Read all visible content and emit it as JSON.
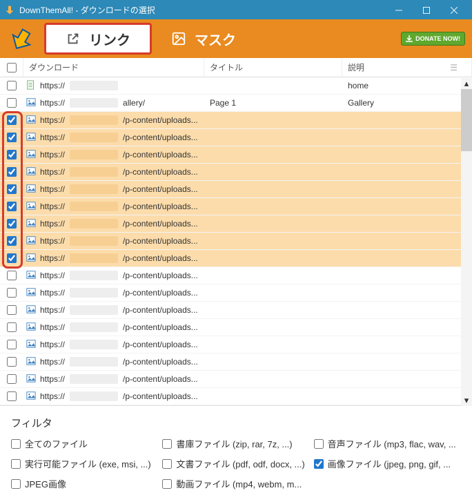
{
  "window": {
    "title": "DownThemAll! - ダウンロードの選択"
  },
  "toolbar": {
    "tab_links": "リンク",
    "tab_media": "マスク",
    "donate": "DONATE NOW!"
  },
  "columns": {
    "download": "ダウンロード",
    "title": "タイトル",
    "description": "説明"
  },
  "rows": [
    {
      "checked": false,
      "selected": false,
      "icon": "page",
      "url_prefix": "https://",
      "url_suffix": "",
      "title": "",
      "desc": "home"
    },
    {
      "checked": false,
      "selected": false,
      "icon": "img",
      "url_prefix": "https://",
      "url_suffix": "allery/",
      "title": "Page 1",
      "desc": "Gallery"
    },
    {
      "checked": true,
      "selected": true,
      "icon": "img",
      "url_prefix": "https://",
      "url_suffix": "/p-content/uploads...",
      "title": "",
      "desc": ""
    },
    {
      "checked": true,
      "selected": true,
      "icon": "img",
      "url_prefix": "https://",
      "url_suffix": "/p-content/uploads...",
      "title": "",
      "desc": ""
    },
    {
      "checked": true,
      "selected": true,
      "icon": "img",
      "url_prefix": "https://",
      "url_suffix": "/p-content/uploads...",
      "title": "",
      "desc": ""
    },
    {
      "checked": true,
      "selected": true,
      "icon": "img",
      "url_prefix": "https://",
      "url_suffix": "/p-content/uploads...",
      "title": "",
      "desc": ""
    },
    {
      "checked": true,
      "selected": true,
      "icon": "img",
      "url_prefix": "https://",
      "url_suffix": "/p-content/uploads...",
      "title": "",
      "desc": ""
    },
    {
      "checked": true,
      "selected": true,
      "icon": "img",
      "url_prefix": "https://",
      "url_suffix": "/p-content/uploads...",
      "title": "",
      "desc": ""
    },
    {
      "checked": true,
      "selected": true,
      "icon": "img",
      "url_prefix": "https://",
      "url_suffix": "/p-content/uploads...",
      "title": "",
      "desc": ""
    },
    {
      "checked": true,
      "selected": true,
      "icon": "img",
      "url_prefix": "https://",
      "url_suffix": "/p-content/uploads...",
      "title": "",
      "desc": ""
    },
    {
      "checked": true,
      "selected": true,
      "icon": "img",
      "url_prefix": "https://",
      "url_suffix": "/p-content/uploads...",
      "title": "",
      "desc": ""
    },
    {
      "checked": false,
      "selected": false,
      "icon": "img",
      "url_prefix": "https://",
      "url_suffix": "/p-content/uploads...",
      "title": "",
      "desc": ""
    },
    {
      "checked": false,
      "selected": false,
      "icon": "img",
      "url_prefix": "https://",
      "url_suffix": "/p-content/uploads...",
      "title": "",
      "desc": ""
    },
    {
      "checked": false,
      "selected": false,
      "icon": "img",
      "url_prefix": "https://",
      "url_suffix": "/p-content/uploads...",
      "title": "",
      "desc": ""
    },
    {
      "checked": false,
      "selected": false,
      "icon": "img",
      "url_prefix": "https://",
      "url_suffix": "/p-content/uploads...",
      "title": "",
      "desc": ""
    },
    {
      "checked": false,
      "selected": false,
      "icon": "img",
      "url_prefix": "https://",
      "url_suffix": "/p-content/uploads...",
      "title": "",
      "desc": ""
    },
    {
      "checked": false,
      "selected": false,
      "icon": "img",
      "url_prefix": "https://",
      "url_suffix": "/p-content/uploads...",
      "title": "",
      "desc": ""
    },
    {
      "checked": false,
      "selected": false,
      "icon": "img",
      "url_prefix": "https://",
      "url_suffix": "/p-content/uploads...",
      "title": "",
      "desc": ""
    },
    {
      "checked": false,
      "selected": false,
      "icon": "img",
      "url_prefix": "https://",
      "url_suffix": "/p-content/uploads...",
      "title": "",
      "desc": ""
    }
  ],
  "filters": {
    "heading": "フィルタ",
    "items": [
      {
        "label": "全てのファイル",
        "checked": false
      },
      {
        "label": "書庫ファイル (zip, rar, 7z, ...)",
        "checked": false
      },
      {
        "label": "音声ファイル (mp3, flac, wav, ...",
        "checked": false
      },
      {
        "label": "実行可能ファイル (exe, msi, ...)",
        "checked": false
      },
      {
        "label": "文書ファイル (pdf, odf, docx, ...)",
        "checked": false
      },
      {
        "label": "画像ファイル (jpeg, png, gif, ...",
        "checked": true
      },
      {
        "label": "JPEG画像",
        "checked": false
      },
      {
        "label": "動画ファイル (mp4, webm, m...",
        "checked": false
      }
    ]
  }
}
